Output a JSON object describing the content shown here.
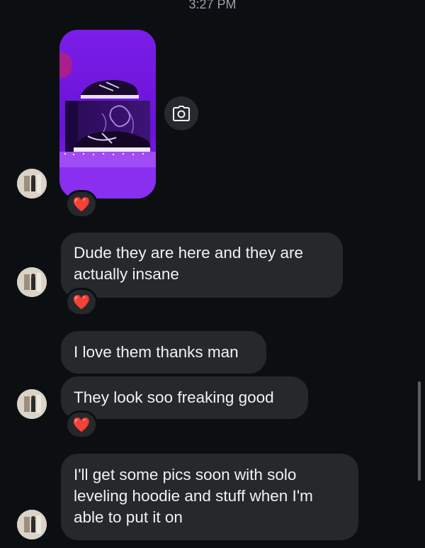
{
  "header": {
    "timestamp": "3:27 PM"
  },
  "messages": [
    {
      "type": "photo",
      "reaction": "❤️"
    },
    {
      "type": "text",
      "text_lines": [
        "Dude they are here and they are",
        "actually insane"
      ],
      "reaction": "❤️"
    },
    {
      "type": "text",
      "text": "I love them thanks man"
    },
    {
      "type": "text",
      "text": "They look soo freaking good",
      "reaction": "❤️"
    },
    {
      "type": "text",
      "text_lines": [
        "I'll get some pics soon with solo",
        "leveling hoodie and stuff when I'm",
        "able to put it on"
      ]
    }
  ],
  "icons": {
    "camera": "camera-icon",
    "avatar": "avatar"
  },
  "colors": {
    "background": "#0c0f12",
    "bubble": "#26282c",
    "text": "#f2f2f2",
    "photo_purple": "#6a14d8",
    "heart": "#ff2d3a"
  }
}
